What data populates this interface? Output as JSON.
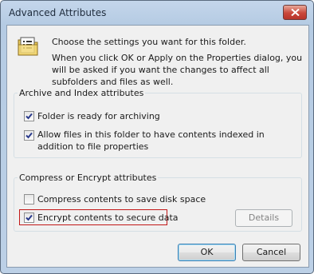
{
  "window": {
    "title": "Advanced Attributes"
  },
  "intro": {
    "line1": "Choose the settings you want for this folder.",
    "line2": "When you click OK or Apply on the Properties dialog, you will be asked if you want the changes to affect all subfolders and files as well."
  },
  "archive_group": {
    "label": "Archive and Index attributes",
    "archiving": {
      "label": "Folder is ready for archiving",
      "checked": true
    },
    "indexing": {
      "label": "Allow files in this folder to have contents indexed in addition to file properties",
      "checked": true
    }
  },
  "encrypt_group": {
    "label": "Compress or Encrypt attributes",
    "compress": {
      "label": "Compress contents to save disk space",
      "checked": false
    },
    "encrypt": {
      "label": "Encrypt contents to secure data",
      "checked": true
    },
    "details_label": "Details"
  },
  "buttons": {
    "ok_label": "OK",
    "cancel_label": "Cancel"
  },
  "colors": {
    "highlight": "#c21818",
    "accent": "#3c7fb1"
  }
}
